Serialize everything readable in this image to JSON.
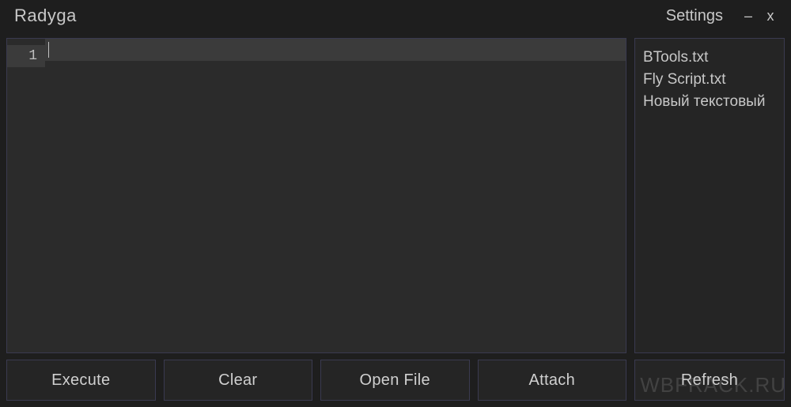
{
  "titlebar": {
    "app_title": "Radyga",
    "settings_label": "Settings",
    "minimize": "–",
    "close": "x"
  },
  "editor": {
    "gutter": {
      "line1": "1"
    },
    "content": ""
  },
  "file_list": {
    "items": [
      "BTools.txt",
      "Fly Script.txt",
      "Новый текстовый"
    ]
  },
  "buttons": {
    "execute": "Execute",
    "clear": "Clear",
    "open_file": "Open File",
    "attach": "Attach",
    "refresh": "Refresh"
  },
  "watermark": "WBFRACK.RU"
}
